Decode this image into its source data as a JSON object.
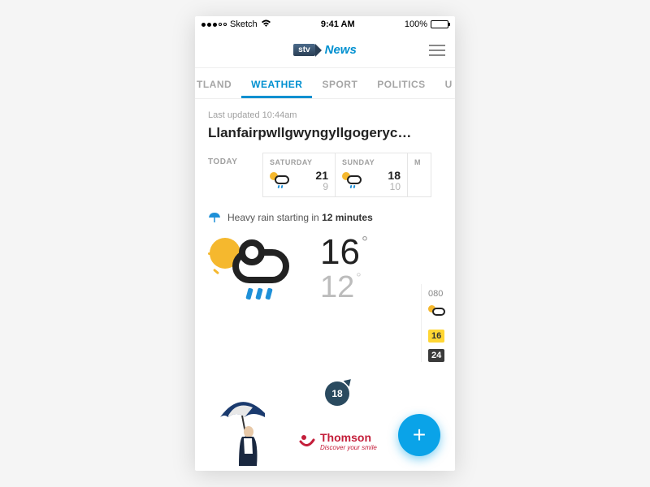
{
  "status": {
    "carrier": "Sketch",
    "time": "9:41 AM",
    "battery": "100%"
  },
  "header": {
    "logo_badge": "stv",
    "logo_text": "News"
  },
  "tabs": [
    {
      "label": "TLAND",
      "active": false
    },
    {
      "label": "WEATHER",
      "active": true
    },
    {
      "label": "SPORT",
      "active": false
    },
    {
      "label": "POLITICS",
      "active": false
    },
    {
      "label": "U",
      "active": false
    }
  ],
  "weather": {
    "last_updated": "Last updated 10:44am",
    "location": "Llanfairpwllgwyngyllgogeryc…",
    "today_label": "TODAY",
    "forecast": [
      {
        "label": "SATURDAY",
        "hi": "21",
        "lo": "9"
      },
      {
        "label": "SUNDAY",
        "hi": "18",
        "lo": "10"
      },
      {
        "label": "M",
        "hi": "",
        "lo": ""
      }
    ],
    "alert_prefix": "Heavy rain starting in ",
    "alert_bold": "12 minutes",
    "current_hi": "16",
    "current_lo": "12",
    "wind": "18"
  },
  "hourly_peek": {
    "time": "080",
    "t1": "16",
    "t2": "24"
  },
  "sponsor": {
    "brand": "Thomson",
    "tagline": "Discover your smile"
  },
  "fab": "+"
}
